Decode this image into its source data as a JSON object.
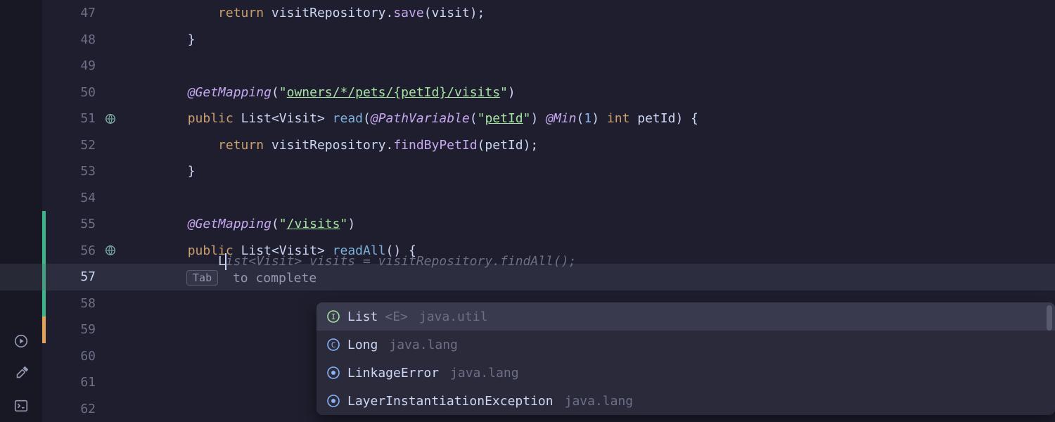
{
  "gutter": {
    "lines": [
      47,
      48,
      49,
      50,
      51,
      52,
      53,
      54,
      55,
      56,
      57,
      58,
      59,
      60,
      61,
      62
    ],
    "icons": {
      "51": "globe",
      "56": "globe"
    },
    "changes": {
      "55": "green",
      "56": "green",
      "57": "green",
      "58": "green",
      "59": "orange"
    }
  },
  "code": {
    "l47": {
      "indent": "            ",
      "kw": "return",
      "sp": " ",
      "a": "visitRepository",
      "dot": ".",
      "b": "save",
      "p1": "(",
      "c": "visit",
      "p2": ");"
    },
    "l48": {
      "indent": "        ",
      "brace": "}"
    },
    "l50": {
      "indent": "        ",
      "ann": "@GetMapping",
      "p1": "(",
      "q1": "\"",
      "s": "owners/*/pets/{petId}/visits",
      "q2": "\"",
      "p2": ")"
    },
    "l51": {
      "indent": "        ",
      "pub": "public",
      "sp1": " ",
      "type": "List",
      "lt": "<",
      "gen": "Visit",
      "gt": ">",
      "sp2": " ",
      "m": "read",
      "p1": "(",
      "ann": "@PathVariable",
      "p2": "(",
      "q1": "\"",
      "s": "petId",
      "q2": "\"",
      "p3": ")",
      "sp3": " ",
      "ann2": "@Min",
      "p4": "(",
      "n": "1",
      "p5": ")",
      "sp4": " ",
      "int": "int",
      "sp5": " ",
      "v": "petId",
      "p6": ") {"
    },
    "l52": {
      "indent": "            ",
      "kw": "return",
      "sp": " ",
      "a": "visitRepository",
      "dot": ".",
      "b": "findByPetId",
      "p1": "(",
      "c": "petId",
      "p2": ");"
    },
    "l53": {
      "indent": "        ",
      "brace": "}"
    },
    "l55": {
      "indent": "        ",
      "ann": "@GetMapping",
      "p1": "(",
      "q1": "\"",
      "s": "/visits",
      "q2": "\"",
      "p2": ")"
    },
    "l56": {
      "indent": "        ",
      "pub": "public",
      "sp1": " ",
      "type": "List",
      "lt": "<",
      "gen": "Visit",
      "gt": ">",
      "sp2": " ",
      "m": "readAll",
      "p1": "() {"
    },
    "l57": {
      "indent": "            ",
      "typed": "L",
      "ghost": "ist<Visit> visits = visitRepository.findAll();"
    }
  },
  "hint": {
    "key": "Tab",
    "text": " to complete"
  },
  "autocomplete": {
    "items": [
      {
        "icon": "interface",
        "name": "List",
        "generic": "<E>",
        "pkg": "java.util",
        "selected": true
      },
      {
        "icon": "class",
        "name": "Long",
        "generic": "",
        "pkg": "java.lang",
        "selected": false
      },
      {
        "icon": "class2",
        "name": "LinkageError",
        "generic": "",
        "pkg": "java.lang",
        "selected": false
      },
      {
        "icon": "class2",
        "name": "LayerInstantiationException",
        "generic": "",
        "pkg": "java.lang",
        "selected": false
      }
    ]
  }
}
